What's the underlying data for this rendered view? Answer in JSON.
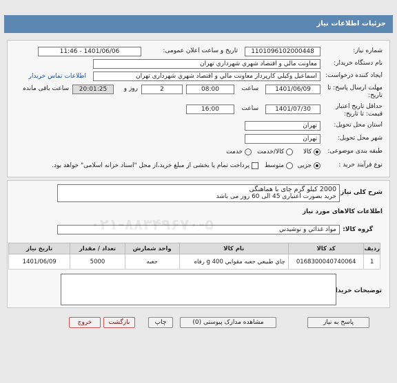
{
  "header": {
    "title": "جزئيات اطلاعات نياز"
  },
  "form": {
    "need_number_label": "شماره نیاز:",
    "need_number": "1101096102000448",
    "announce_label": "تاريخ و ساعت اعلان عمومی:",
    "announce_value": "1401/06/06 - 11:46",
    "buyer_org_label": "نام دستگاه خریدار:",
    "buyer_org": "معاونت مالي و اقتصاد شهري شهرداري تهران",
    "requester_label": "ایجاد کننده درخواست:",
    "requester": "اسماعيل وکيلي کارپرداز معاونت مالي و اقتصاد شهري شهرداري تهران",
    "contact_link": "اطلاعات تماس خریدار",
    "deadline_label": "مهلت ارسال پاسخ: تا تاریخ:",
    "deadline_date": "1401/06/09",
    "time_label": "ساعت",
    "deadline_time": "08:00",
    "days_value": "2",
    "days_label": "روز و",
    "remaining_time": "20:01:25",
    "remaining_label": "ساعت باقی مانده",
    "validity_label": "حداقل تاریخ اعتبار قیمت: تا تاریخ:",
    "validity_date": "1401/07/30",
    "validity_time_label": "ساعت",
    "validity_time": "16:00",
    "province_label": "استان محل تحویل:",
    "province": "تهران",
    "city_label": "شهر محل تحویل:",
    "city": "تهران",
    "category_label": "طبقه بندی موضوعی:",
    "category_options": [
      "کالا",
      "کالا/خدمت",
      "خدمت"
    ],
    "purchase_label": "نوع فرآیند خرید :",
    "purchase_options": [
      "جزیی",
      "متوسط"
    ],
    "payment_note": "پرداخت تمام یا بخشی از مبلغ خرید،از محل \"اسناد خزانه اسلامی\" خواهد بود."
  },
  "description": {
    "label": "شرح کلی نیاز:",
    "line1": "2000 کیلو گرم چای با هماهنگی",
    "line2": "خرید بصورت اعتباری 45 الی 60 روز می باشد"
  },
  "goods": {
    "section_title": "اطلاعات کالاهای مورد نیاز",
    "group_label": "گروه کالا:",
    "group_value": "مواد غذائي و نوشيدني",
    "columns": [
      "ردیف",
      "کد کالا",
      "نام کالا",
      "واحد شمارش",
      "تعداد / مقدار",
      "تاریخ نیاز"
    ],
    "rows": [
      [
        "1",
        "0168300040740064",
        "چاي طبيعي جعبه مقوايي 400 g رفاه",
        "جعبه",
        "5000",
        "1401/06/09"
      ]
    ]
  },
  "buyer_notes": {
    "label": "توضیحات خریدار:",
    "value": ""
  },
  "buttons": {
    "reply": "پاسخ به نياز",
    "attachments": "مشاهده مدارک پیوستی (0)",
    "print": "چاپ",
    "back": "بازگشت",
    "exit": "خروج"
  }
}
